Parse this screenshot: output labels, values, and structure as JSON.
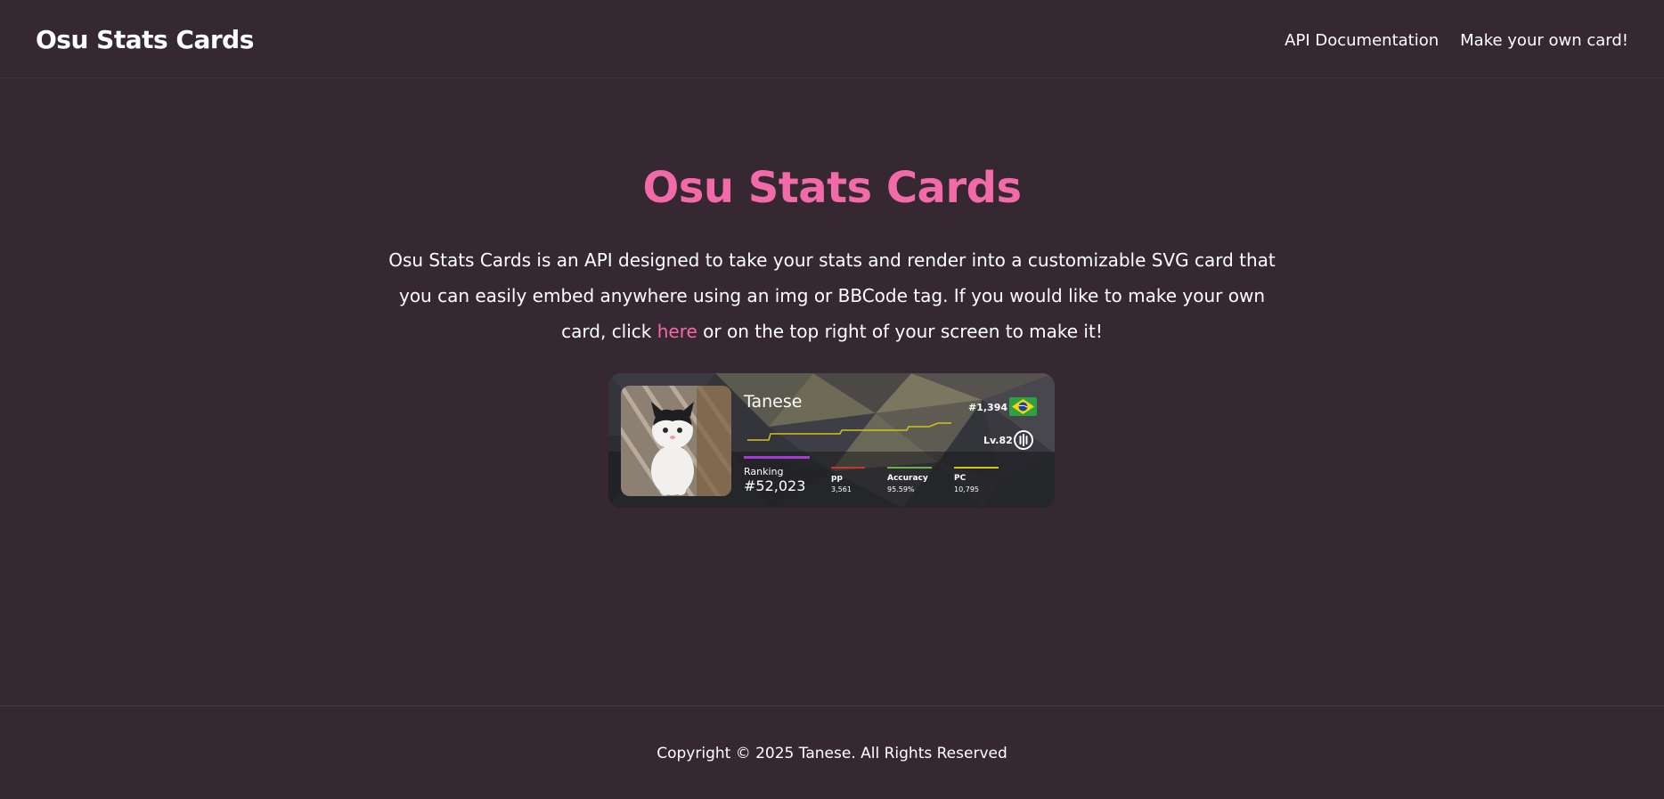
{
  "header": {
    "brand": "Osu Stats Cards",
    "nav": [
      {
        "label": "API Documentation"
      },
      {
        "label": "Make your own card!"
      }
    ]
  },
  "main": {
    "title": "Osu Stats Cards",
    "description_before_link": "Osu Stats Cards is an API designed to take your stats and render into a customizable SVG card that you can easily embed anywhere using an img or BBCode tag. If you would like to make your own card, click ",
    "link_text": "here",
    "description_after_link": " or on the top right of your screen to make it!"
  },
  "card": {
    "username": "Tanese",
    "country_rank": "#1,394",
    "country_flag": "brazil-flag",
    "level": "Lv.82",
    "ranking_label": "Ranking",
    "ranking_value": "#52,023",
    "stats": [
      {
        "label": "pp",
        "value": "3,561",
        "color": "#c0392b"
      },
      {
        "label": "Accuracy",
        "value": "95.59%",
        "color": "#6ab04c"
      },
      {
        "label": "PC",
        "value": "10,795",
        "color": "#d4c21a"
      }
    ],
    "ranking_color": "#a63ad4",
    "rank_history_color": "#d4c21a"
  },
  "footer": {
    "copyright": "Copyright © 2025 Tanese. All Rights Reserved"
  },
  "colors": {
    "background": "#352830",
    "accent": "#f36aa9",
    "text": "#ffffff"
  }
}
